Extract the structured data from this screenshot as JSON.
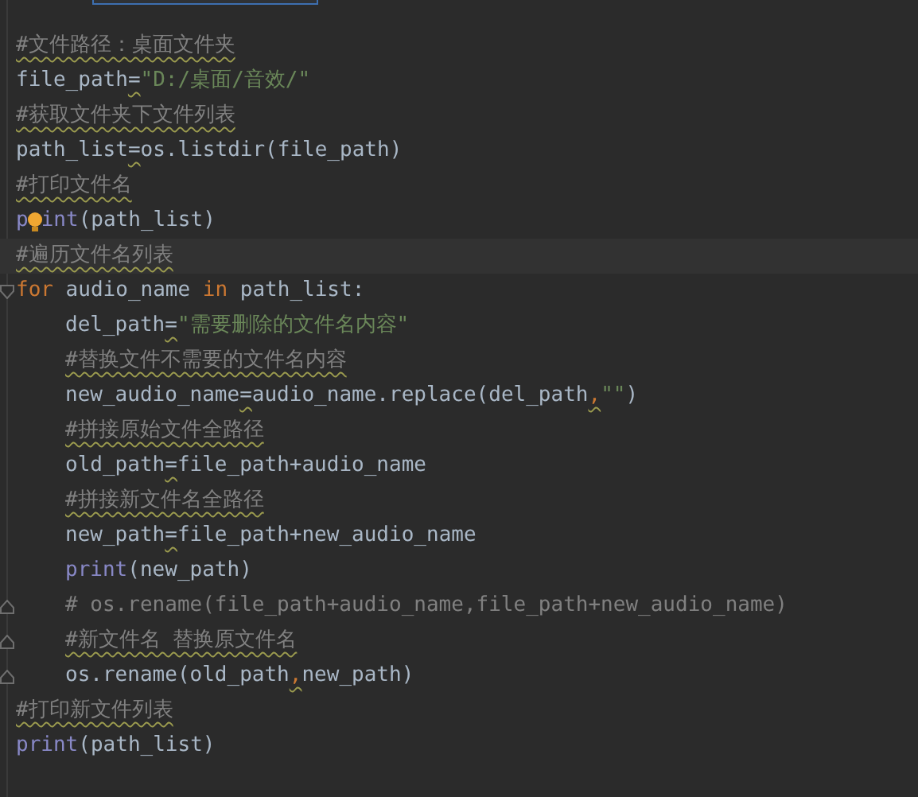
{
  "search_field": {
    "focused": true
  },
  "lines": [
    {
      "tokens": [
        {
          "kind": "comment",
          "text": "#文件路径：桌面文件夹",
          "warn": true
        }
      ]
    },
    {
      "tokens": [
        {
          "kind": "plain",
          "text": "file_path",
          "warn": false
        },
        {
          "kind": "plain",
          "text": "=",
          "warn": true
        },
        {
          "kind": "string",
          "text": "\"D:/桌面/音效/\"",
          "warn": false
        }
      ]
    },
    {
      "tokens": [
        {
          "kind": "comment",
          "text": "#获取文件夹下文件列表",
          "warn": true
        }
      ]
    },
    {
      "tokens": [
        {
          "kind": "plain",
          "text": "path_list",
          "warn": false
        },
        {
          "kind": "plain",
          "text": "=",
          "warn": true
        },
        {
          "kind": "plain",
          "text": "os.listdir(file_path)",
          "warn": false
        }
      ]
    },
    {
      "tokens": [
        {
          "kind": "comment",
          "text": "#打印文件名",
          "warn": true
        }
      ]
    },
    {
      "tokens": [
        {
          "kind": "builtin",
          "text": "p",
          "warn": false
        },
        {
          "kind": "bulb"
        },
        {
          "kind": "builtin",
          "text": "int",
          "warn": false
        },
        {
          "kind": "plain",
          "text": "(path_list)",
          "warn": false
        }
      ]
    },
    {
      "current": true,
      "tokens": [
        {
          "kind": "comment",
          "text": "#遍历文件名列表",
          "warn": true
        }
      ]
    },
    {
      "fold_open": true,
      "tokens": [
        {
          "kind": "keyword",
          "text": "for",
          "warn": false
        },
        {
          "kind": "plain",
          "text": " audio_name ",
          "warn": false
        },
        {
          "kind": "keyword",
          "text": "in",
          "warn": false
        },
        {
          "kind": "plain",
          "text": " path_list:",
          "warn": false
        }
      ],
      "children": [
        {
          "tokens": [
            {
              "kind": "plain",
              "text": "del_path",
              "warn": false
            },
            {
              "kind": "plain",
              "text": "=",
              "warn": true
            },
            {
              "kind": "string",
              "text": "\"需要删除的文件名内容\"",
              "warn": false
            }
          ]
        },
        {
          "tokens": [
            {
              "kind": "comment",
              "text": "#替换文件不需要的文件名内容",
              "warn": true
            }
          ]
        },
        {
          "tokens": [
            {
              "kind": "plain",
              "text": "new_audio_name",
              "warn": false
            },
            {
              "kind": "plain",
              "text": "=",
              "warn": true
            },
            {
              "kind": "plain",
              "text": "audio_name.replace(del_path",
              "warn": false
            },
            {
              "kind": "keyword",
              "text": ",",
              "warn": true
            },
            {
              "kind": "string",
              "text": "\"\"",
              "warn": false
            },
            {
              "kind": "plain",
              "text": ")",
              "warn": false
            }
          ]
        },
        {
          "tokens": [
            {
              "kind": "comment",
              "text": "#拼接原始文件全路径",
              "warn": true
            }
          ]
        },
        {
          "tokens": [
            {
              "kind": "plain",
              "text": "old_path",
              "warn": false
            },
            {
              "kind": "plain",
              "text": "=",
              "warn": true
            },
            {
              "kind": "plain",
              "text": "file_path+audio_name",
              "warn": false
            }
          ]
        },
        {
          "tokens": [
            {
              "kind": "comment",
              "text": "#拼接新文件名全路径",
              "warn": true
            }
          ]
        },
        {
          "tokens": [
            {
              "kind": "plain",
              "text": "new_path",
              "warn": false
            },
            {
              "kind": "plain",
              "text": "=",
              "warn": true
            },
            {
              "kind": "plain",
              "text": "file_path+new_audio_name",
              "warn": false
            }
          ]
        },
        {
          "tokens": [
            {
              "kind": "builtin",
              "text": "print",
              "warn": false
            },
            {
              "kind": "plain",
              "text": "(new_path)",
              "warn": false
            }
          ]
        },
        {
          "fold_close": true,
          "tokens": [
            {
              "kind": "comment",
              "text": "# os.rename(file_path+audio_name,file_path+new_audio_name)",
              "warn": false
            }
          ]
        },
        {
          "fold_close": true,
          "tokens": [
            {
              "kind": "comment",
              "text": "#新文件名 替换原文件名",
              "warn": true
            }
          ]
        },
        {
          "fold_close": true,
          "tokens": [
            {
              "kind": "plain",
              "text": "os.rename(old_path",
              "warn": false
            },
            {
              "kind": "keyword",
              "text": ",",
              "warn": true
            },
            {
              "kind": "plain",
              "text": "new_path)",
              "warn": false
            }
          ]
        }
      ]
    },
    {
      "tokens": [
        {
          "kind": "comment",
          "text": "#打印新文件列表",
          "warn": true
        }
      ]
    },
    {
      "tokens": [
        {
          "kind": "builtin",
          "text": "print",
          "warn": false
        },
        {
          "kind": "plain",
          "text": "(path_list)",
          "warn": false
        }
      ]
    }
  ]
}
